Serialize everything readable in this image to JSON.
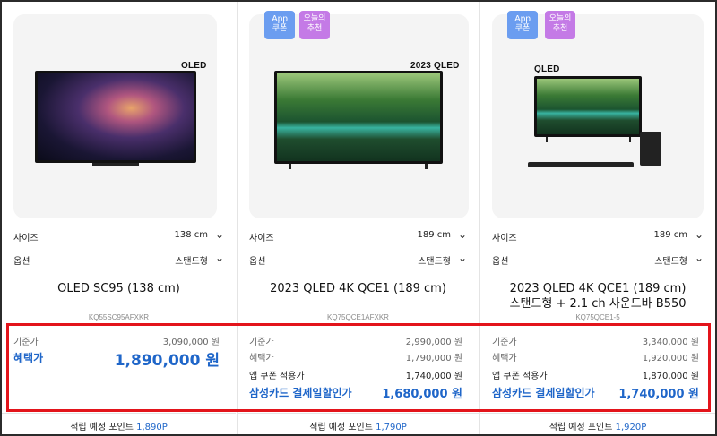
{
  "products": [
    {
      "brand_mark": "OLED",
      "badges": [],
      "size_label": "사이즈",
      "size_value": "138 cm",
      "option_label": "옵션",
      "option_value": "스탠드형",
      "title_line1": "OLED SC95 (138 cm)",
      "title_line2": "",
      "model": "KQ55SC95AFXKR",
      "prices": [
        {
          "label": "기준가",
          "value": "3,090,000 원"
        },
        {
          "label": "혜택가",
          "value": "1,890,000 원"
        }
      ],
      "points_label": "적립 예정 포인트",
      "points_value": "1,890P"
    },
    {
      "brand_mark": "2023 QLED",
      "badges": [
        {
          "line1": "App",
          "line2": "쿠폰"
        },
        {
          "line1": "오늘의",
          "line2": "추천"
        }
      ],
      "size_label": "사이즈",
      "size_value": "189 cm",
      "option_label": "옵션",
      "option_value": "스탠드형",
      "title_line1": "2023 QLED 4K QCE1 (189 cm)",
      "title_line2": "",
      "model": "KQ75QCE1AFXKR",
      "prices": [
        {
          "label": "기준가",
          "value": "2,990,000 원"
        },
        {
          "label": "혜택가",
          "value": "1,790,000 원"
        },
        {
          "label": "앱 쿠폰 적용가",
          "value": "1,740,000 원"
        },
        {
          "label": "삼성카드 결제일할인가",
          "value": "1,680,000 원"
        }
      ],
      "points_label": "적립 예정 포인트",
      "points_value": "1,790P"
    },
    {
      "brand_mark": "QLED",
      "badges": [
        {
          "line1": "App",
          "line2": "쿠폰"
        },
        {
          "line1": "오늘의",
          "line2": "추천"
        }
      ],
      "size_label": "사이즈",
      "size_value": "189 cm",
      "option_label": "옵션",
      "option_value": "스탠드형",
      "title_line1": "2023 QLED 4K QCE1 (189 cm)",
      "title_line2": "스탠드형 + 2.1 ch 사운드바 B550",
      "model": "KQ75QCE1-5",
      "prices": [
        {
          "label": "기준가",
          "value": "3,340,000 원"
        },
        {
          "label": "혜택가",
          "value": "1,920,000 원"
        },
        {
          "label": "앱 쿠폰 적용가",
          "value": "1,870,000 원"
        },
        {
          "label": "삼성카드 결제일할인가",
          "value": "1,740,000 원"
        }
      ],
      "points_label": "적립 예정 포인트",
      "points_value": "1,920P"
    }
  ],
  "colors": {
    "accent_blue": "#1f66c9",
    "highlight_red": "#e3141b",
    "badge_app": "#6b9df0",
    "badge_today": "#c47ae6"
  }
}
